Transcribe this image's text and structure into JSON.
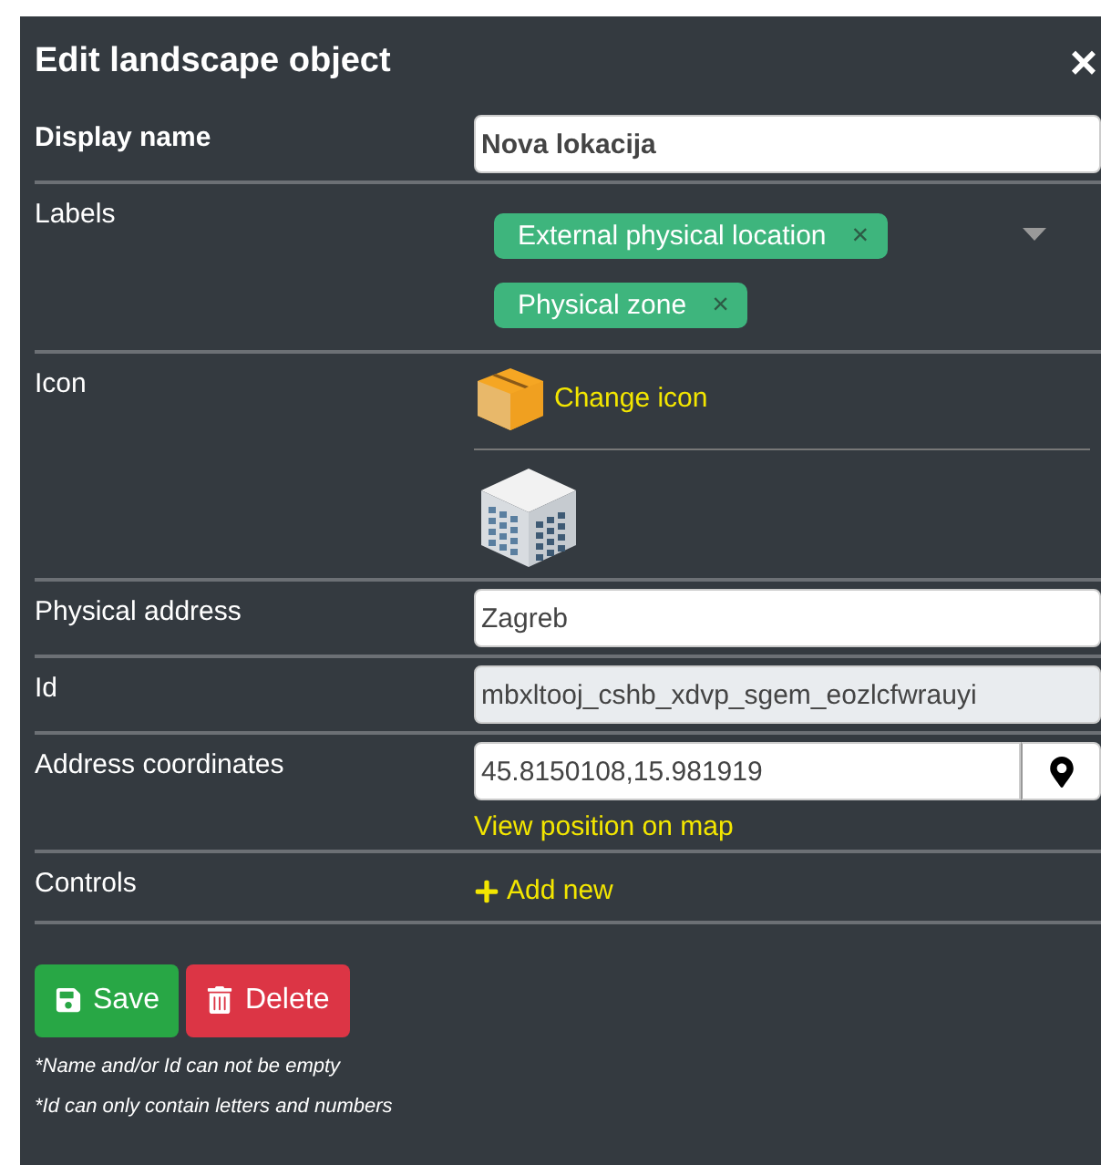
{
  "dialog": {
    "title": "Edit landscape object",
    "close": "×"
  },
  "display_name": {
    "label": "Display name",
    "value": "Nova lokacija"
  },
  "labels": {
    "label": "Labels",
    "tags": [
      {
        "text": "External physical location",
        "remove": "×"
      },
      {
        "text": "Physical zone",
        "remove": "×"
      }
    ]
  },
  "icon": {
    "label": "Icon",
    "change_link": "Change icon"
  },
  "physical_address": {
    "label": "Physical address",
    "value": "Zagreb"
  },
  "id": {
    "label": "Id",
    "value": "mbxltooj_cshb_xdvp_sgem_eozlcfwrauyi",
    "disabled": true
  },
  "address_coordinates": {
    "label": "Address coordinates",
    "value": "45.8150108,15.981919",
    "map_link": "View position on map"
  },
  "controls": {
    "label": "Controls",
    "add": "Add new"
  },
  "buttons": [
    {
      "kind": "save",
      "label": "Save"
    },
    {
      "kind": "delete",
      "label": "Delete"
    }
  ],
  "notes": [
    "*Name and/or Id can not be empty",
    "*Id can only contain letters and numbers"
  ]
}
